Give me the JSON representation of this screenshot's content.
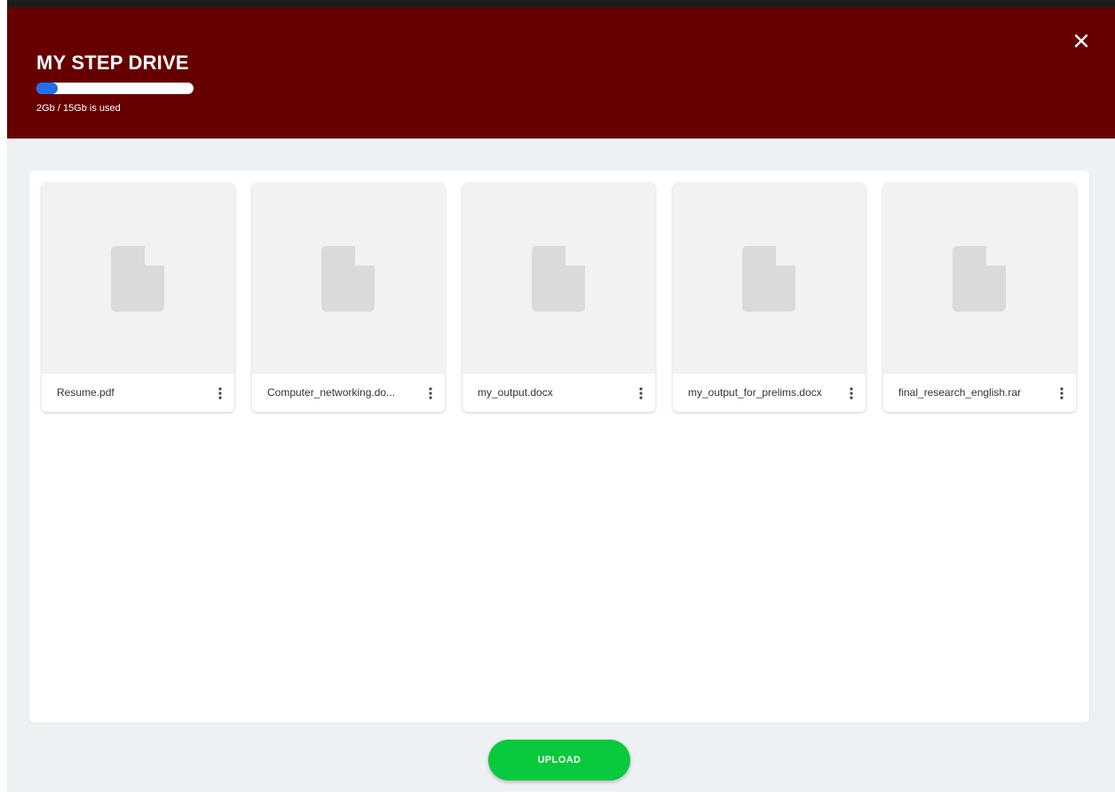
{
  "header": {
    "title": "MY STEP DRIVE",
    "usage_text": "2Gb / 15Gb is used",
    "usage_fraction": 0.133,
    "close_icon": "close-icon",
    "background_color": "#660000"
  },
  "files": [
    {
      "name": "Resume.pdf",
      "icon": "file-icon"
    },
    {
      "name": "Computer_networking.do...",
      "icon": "file-icon"
    },
    {
      "name": "my_output.docx",
      "icon": "file-icon"
    },
    {
      "name": "my_output_for_prelims.docx",
      "icon": "file-icon"
    },
    {
      "name": "final_research_english.rar",
      "icon": "file-icon"
    }
  ],
  "upload": {
    "label": "UPLOAD",
    "color": "#09c93c"
  }
}
